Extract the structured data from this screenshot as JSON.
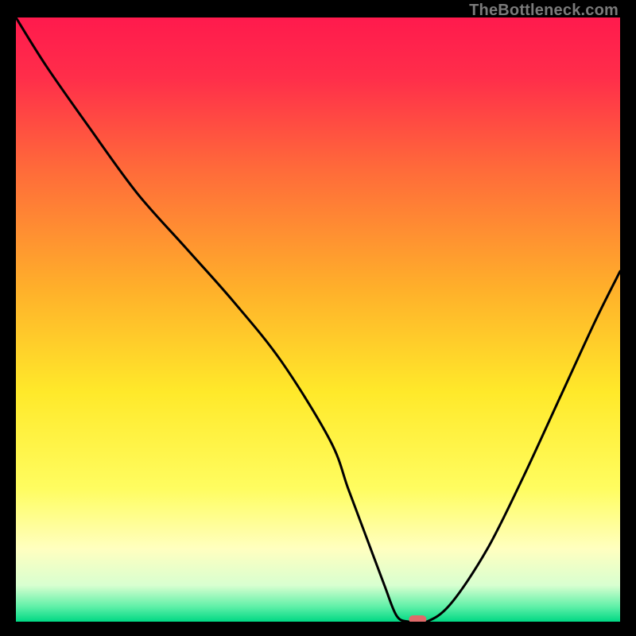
{
  "attribution": "TheBottleneck.com",
  "colors": {
    "frame": "#000000",
    "attribution_text": "#7a7a7a",
    "curve": "#000000",
    "marker": "#e06a6a",
    "gradient_stops": [
      {
        "offset": 0.0,
        "color": "#ff1a4d"
      },
      {
        "offset": 0.1,
        "color": "#ff2e4a"
      },
      {
        "offset": 0.25,
        "color": "#ff6a3a"
      },
      {
        "offset": 0.45,
        "color": "#ffb02a"
      },
      {
        "offset": 0.62,
        "color": "#ffe92a"
      },
      {
        "offset": 0.78,
        "color": "#fffd60"
      },
      {
        "offset": 0.88,
        "color": "#ffffc0"
      },
      {
        "offset": 0.94,
        "color": "#d8ffd0"
      },
      {
        "offset": 0.975,
        "color": "#60f0a8"
      },
      {
        "offset": 1.0,
        "color": "#00d884"
      }
    ]
  },
  "chart_data": {
    "type": "line",
    "title": "",
    "xlabel": "",
    "ylabel": "",
    "xlim": [
      0,
      100
    ],
    "ylim": [
      0,
      100
    ],
    "grid": false,
    "x": [
      0,
      5,
      12,
      20,
      28,
      36,
      44,
      52,
      55,
      58,
      61,
      63,
      65,
      68,
      72,
      78,
      84,
      90,
      96,
      100
    ],
    "series": [
      {
        "name": "bottleneck-curve",
        "values": [
          100,
          92,
          82,
          71,
          62,
          53,
          43,
          30,
          22,
          14,
          6,
          1,
          0,
          0,
          3,
          12,
          24,
          37,
          50,
          58
        ]
      }
    ],
    "marker": {
      "x": 66.5,
      "y": 0
    },
    "legend": null
  }
}
